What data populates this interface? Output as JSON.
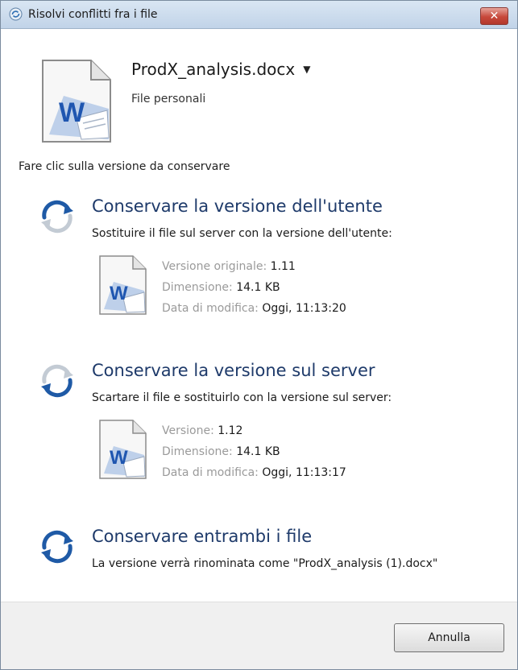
{
  "window": {
    "title": "Risolvi conflitti fra i file",
    "close_symbol": "✕"
  },
  "file": {
    "name": "ProdX_analysis.docx",
    "location": "File personali",
    "icon": "word-document-icon"
  },
  "instruction": "Fare clic sulla versione da conservare",
  "options": [
    {
      "title": "Conservare la versione dell'utente",
      "description": "Sostituire il file sul server con la versione dell'utente:",
      "details": [
        {
          "label": "Versione originale:",
          "value": "1.11"
        },
        {
          "label": "Dimensione:",
          "value": "14.1 KB"
        },
        {
          "label": "Data di modifica:",
          "value": "Oggi, 11:13:20"
        }
      ]
    },
    {
      "title": "Conservare la versione sul server",
      "description": "Scartare il file e sostituirlo con la versione sul server:",
      "details": [
        {
          "label": "Versione:",
          "value": "1.12"
        },
        {
          "label": "Dimensione:",
          "value": "14.1 KB"
        },
        {
          "label": "Data di modifica:",
          "value": "Oggi, 11:13:17"
        }
      ]
    },
    {
      "title": "Conservare entrambi i file",
      "description": "La versione verrà rinominata come \"ProdX_analysis (1).docx\""
    }
  ],
  "buttons": {
    "cancel": "Annulla"
  },
  "colors": {
    "option_title": "#1e3a6a",
    "sync_icon_active": "#1f5aa6",
    "sync_icon_inactive": "#b8c0c8",
    "close_button": "#c7483b"
  }
}
